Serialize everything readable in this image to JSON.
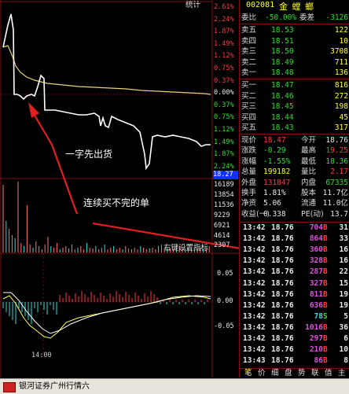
{
  "chart": {
    "header_label": "统计",
    "right_pct_ticks": [
      {
        "t": "2.61%",
        "c": "red"
      },
      {
        "t": "2.24%",
        "c": "red"
      },
      {
        "t": "1.87%",
        "c": "red"
      },
      {
        "t": "1.49%",
        "c": "red"
      },
      {
        "t": "1.12%",
        "c": "red"
      },
      {
        "t": "0.75%",
        "c": "red"
      },
      {
        "t": "0.37%",
        "c": "red"
      },
      {
        "t": "0.00%",
        "c": "wht"
      },
      {
        "t": "0.37%",
        "c": "grn"
      },
      {
        "t": "0.75%",
        "c": "grn"
      },
      {
        "t": "1.12%",
        "c": "grn"
      },
      {
        "t": "1.49%",
        "c": "grn"
      },
      {
        "t": "1.87%",
        "c": "grn"
      },
      {
        "t": "2.24%",
        "c": "grn"
      }
    ],
    "price_marker": "18.27",
    "volume_ticks": [
      "16189",
      "13854",
      "11536",
      "9229",
      "6921",
      "4614",
      "2307"
    ],
    "indicator_label": "右键设置指标",
    "macd_ticks": [
      "0.05",
      "0.00",
      "-0.05"
    ],
    "time_label": "14:00",
    "annotation1": "一字先出货",
    "annotation2": "连续买不完的单",
    "colors": {
      "price_line": "#ffffff",
      "avg_line": "#e8d27a",
      "up": "#ff3b3b",
      "down": "#33dddd",
      "arrow": "#e02020"
    }
  },
  "quote": {
    "code": "002081",
    "name": "金 螳 螂",
    "weibi_label": "委比",
    "weibi_value": "-50.00%",
    "weicha_label": "委差",
    "weicha_value": "-3126",
    "sell": [
      {
        "label": "卖五",
        "price": "18.53",
        "vol": "122"
      },
      {
        "label": "卖四",
        "price": "18.51",
        "vol": "10"
      },
      {
        "label": "卖三",
        "price": "18.50",
        "vol": "3708"
      },
      {
        "label": "卖二",
        "price": "18.49",
        "vol": "711"
      },
      {
        "label": "卖一",
        "price": "18.48",
        "vol": "136"
      }
    ],
    "buy": [
      {
        "label": "买一",
        "price": "18.47",
        "vol": "816"
      },
      {
        "label": "买二",
        "price": "18.46",
        "vol": "272"
      },
      {
        "label": "买三",
        "price": "18.45",
        "vol": "198"
      },
      {
        "label": "买四",
        "price": "18.44",
        "vol": "45"
      },
      {
        "label": "买五",
        "price": "18.43",
        "vol": "317"
      }
    ],
    "stats": [
      {
        "l1": "现价",
        "v1": "18.47",
        "c1": "red",
        "l2": "今开",
        "v2": "18.76",
        "c2": "wht"
      },
      {
        "l1": "涨跌",
        "v1": "-0.29",
        "c1": "grn",
        "l2": "最高",
        "v2": "19.25",
        "c2": "red"
      },
      {
        "l1": "涨幅",
        "v1": "-1.55%",
        "c1": "grn",
        "l2": "最低",
        "v2": "18.36",
        "c2": "grn"
      },
      {
        "l1": "总量",
        "v1": "199182",
        "c1": "yel",
        "l2": "量比",
        "v2": "2.17",
        "c2": "red"
      },
      {
        "l1": "外盘",
        "v1": "131847",
        "c1": "red",
        "l2": "内盘",
        "v2": "67335",
        "c2": "grn"
      },
      {
        "l1": "换手",
        "v1": "1.81%",
        "c1": "wht",
        "l2": "股本",
        "v2": "11.7亿",
        "c2": "wht"
      },
      {
        "l1": "净资",
        "v1": "5.06",
        "c1": "wht",
        "l2": "流通",
        "v2": "11.0亿",
        "c2": "wht"
      },
      {
        "l1": "收益(一)",
        "v1": "0.338",
        "c1": "wht",
        "l2": "PE(动)",
        "v2": "13.7",
        "c2": "wht"
      }
    ],
    "trades": [
      {
        "time": "13:42",
        "price": "18.76",
        "vol": "704",
        "bs": "B",
        "n": "31"
      },
      {
        "time": "13:42",
        "price": "18.76",
        "vol": "864",
        "bs": "B",
        "n": "33"
      },
      {
        "time": "13:42",
        "price": "18.76",
        "vol": "360",
        "bs": "B",
        "n": "16"
      },
      {
        "time": "13:42",
        "price": "18.76",
        "vol": "328",
        "bs": "B",
        "n": "16"
      },
      {
        "time": "13:42",
        "price": "18.76",
        "vol": "287",
        "bs": "B",
        "n": "22"
      },
      {
        "time": "13:42",
        "price": "18.76",
        "vol": "327",
        "bs": "B",
        "n": "15"
      },
      {
        "time": "13:42",
        "price": "18.76",
        "vol": "811",
        "bs": "B",
        "n": "19"
      },
      {
        "time": "13:42",
        "price": "18.76",
        "vol": "636",
        "bs": "B",
        "n": "19"
      },
      {
        "time": "13:42",
        "price": "18.76",
        "vol": "78",
        "bs": "S",
        "n": "5"
      },
      {
        "time": "13:42",
        "price": "18.76",
        "vol": "1016",
        "bs": "B",
        "n": "36"
      },
      {
        "time": "13:42",
        "price": "18.76",
        "vol": "297",
        "bs": "B",
        "n": "6"
      },
      {
        "time": "13:42",
        "price": "18.76",
        "vol": "210",
        "bs": "B",
        "n": "10"
      },
      {
        "time": "13:43",
        "price": "18.76",
        "vol": "86",
        "bs": "B",
        "n": "8"
      }
    ],
    "tabs": [
      "笔",
      "价",
      "细",
      "盘",
      "势",
      "联",
      "值",
      "主"
    ]
  },
  "status_bar": {
    "text": "银河证券广州行情六"
  }
}
